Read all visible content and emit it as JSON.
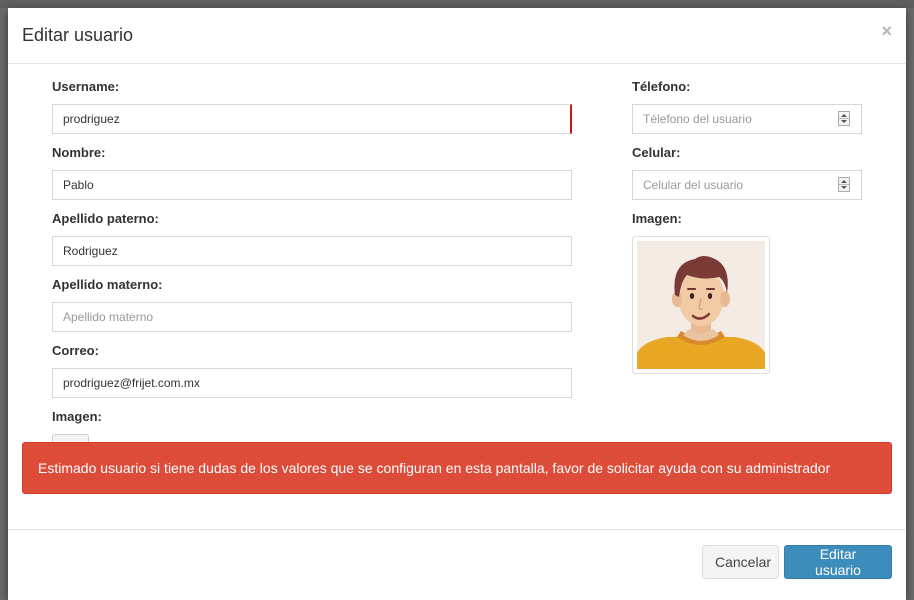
{
  "modal": {
    "title": "Editar usuario",
    "close_symbol": "×"
  },
  "form": {
    "username": {
      "label": "Username:",
      "value": "prodriguez"
    },
    "nombre": {
      "label": "Nombre:",
      "value": "Pablo"
    },
    "apellido_paterno": {
      "label": "Apellido paterno:",
      "value": "Rodriguez"
    },
    "apellido_materno": {
      "label": "Apellido materno:",
      "value": "",
      "placeholder": "Apellido materno"
    },
    "correo": {
      "label": "Correo:",
      "value": "prodriguez@frijet.com.mx"
    },
    "imagen_upload": {
      "label": "Imagen:",
      "icon": "paperclip-icon"
    },
    "telefono": {
      "label": "Télefono:",
      "value": "",
      "placeholder": "Télefono del usuario"
    },
    "celular": {
      "label": "Celular:",
      "value": "",
      "placeholder": "Celular del usuario"
    },
    "imagen_preview": {
      "label": "Imagen:",
      "icon": "user-avatar-icon"
    }
  },
  "alert": {
    "message": "Estimado usuario si tiene dudas de los valores que se configuran en esta pantalla, favor de solicitar ayuda con su administrador"
  },
  "footer": {
    "cancel_label": "Cancelar",
    "submit_label": "Editar usuario"
  },
  "colors": {
    "alert_bg": "#dd4b39",
    "primary": "#3c8dbc",
    "error_edge": "#dd1111"
  }
}
